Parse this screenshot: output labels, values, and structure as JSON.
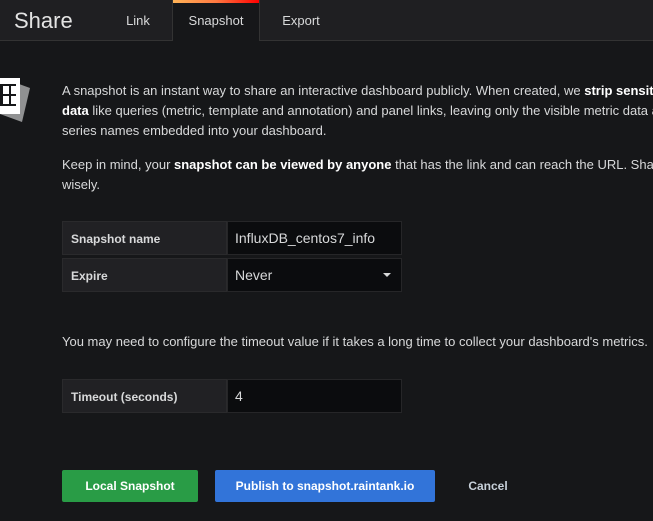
{
  "header": {
    "title": "Share",
    "tabs": [
      {
        "label": "Link"
      },
      {
        "label": "Snapshot"
      },
      {
        "label": "Export"
      }
    ],
    "active_tab": "Snapshot"
  },
  "intro": {
    "p1a": "A snapshot is an instant way to share an interactive dashboard publicly. When created, we ",
    "p1b": "strip sensitive",
    "p2a": "data",
    "p2b": " like queries (metric, template and annotation) and panel links, leaving only the visible metric data and",
    "p3": "series names embedded into your dashboard.",
    "p4a": "Keep in mind, your ",
    "p4b": "snapshot can be viewed by anyone",
    "p4c": " that has the link and can reach the URL. Share",
    "p5": "wisely."
  },
  "form": {
    "name_label": "Snapshot name",
    "name_value": "InfluxDB_centos7_info",
    "expire_label": "Expire",
    "expire_value": "Never",
    "timeout_note": "You may need to configure the timeout value if it takes a long time to collect your dashboard's metrics.",
    "timeout_label": "Timeout (seconds)",
    "timeout_value": "4"
  },
  "buttons": {
    "local": "Local Snapshot",
    "publish": "Publish to snapshot.raintank.io",
    "cancel": "Cancel"
  },
  "colors": {
    "local": "#299c46",
    "publish": "#3274d9"
  }
}
